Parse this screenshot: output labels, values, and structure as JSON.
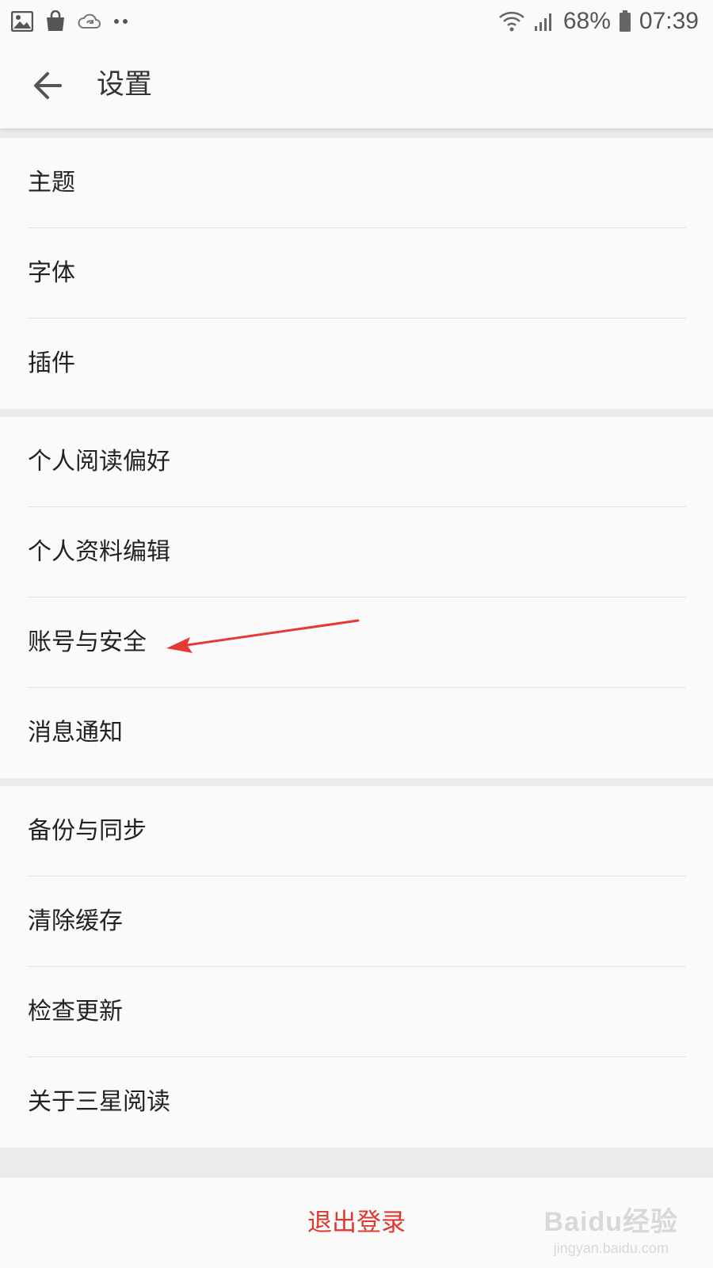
{
  "status_bar": {
    "battery": "68%",
    "time": "07:39",
    "left_icons": [
      "gallery-icon",
      "shopping-bag-icon",
      "cloud-sync-icon",
      "more-notifications-icon"
    ],
    "right_icons": [
      "wifi-icon",
      "signal-icon",
      "battery-icon"
    ]
  },
  "header": {
    "back_icon": "arrow-left-icon",
    "title": "设置"
  },
  "groups": [
    {
      "items": [
        {
          "label": "主题"
        },
        {
          "label": "字体"
        },
        {
          "label": "插件"
        }
      ]
    },
    {
      "items": [
        {
          "label": "个人阅读偏好"
        },
        {
          "label": "个人资料编辑"
        },
        {
          "label": "账号与安全"
        },
        {
          "label": "消息通知"
        }
      ]
    },
    {
      "items": [
        {
          "label": "备份与同步"
        },
        {
          "label": "清除缓存"
        },
        {
          "label": "检查更新"
        },
        {
          "label": "关于三星阅读"
        }
      ]
    }
  ],
  "logout": {
    "label": "退出登录",
    "color": "#e0382f"
  },
  "annotation": {
    "type": "red-arrow",
    "points_to": "账号与安全",
    "color": "#e53935"
  },
  "watermark": {
    "logo": "Baidu经验",
    "url": "jingyan.baidu.com"
  }
}
